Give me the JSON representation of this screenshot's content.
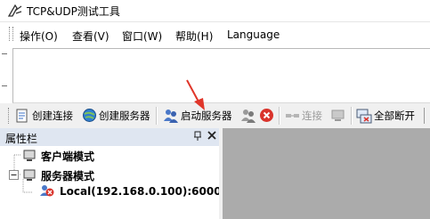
{
  "window": {
    "title": "TCP&UDP测试工具"
  },
  "menu": {
    "items": [
      {
        "label": "操作(O)"
      },
      {
        "label": "查看(V)"
      },
      {
        "label": "窗口(W)"
      },
      {
        "label": "帮助(H)"
      },
      {
        "label": "Language"
      }
    ]
  },
  "toolbar": {
    "create_connection": "创建连接",
    "create_server": "创建服务器",
    "start_server": "启动服务器",
    "connect": "连接",
    "disconnect_all": "全部断开"
  },
  "properties_panel": {
    "title": "属性栏",
    "pin_glyph": "ᵖ",
    "close_glyph": "✕",
    "tree": {
      "client_mode": "客户端模式",
      "server_mode": "服务器模式",
      "server_entry": "Local(192.168.0.100):6000"
    }
  },
  "colors": {
    "accent_arrow": "#e0362a",
    "panel_header": "#dfe6f1",
    "workspace": "#ababab",
    "toolbar_bg": "#f0f0f0"
  }
}
